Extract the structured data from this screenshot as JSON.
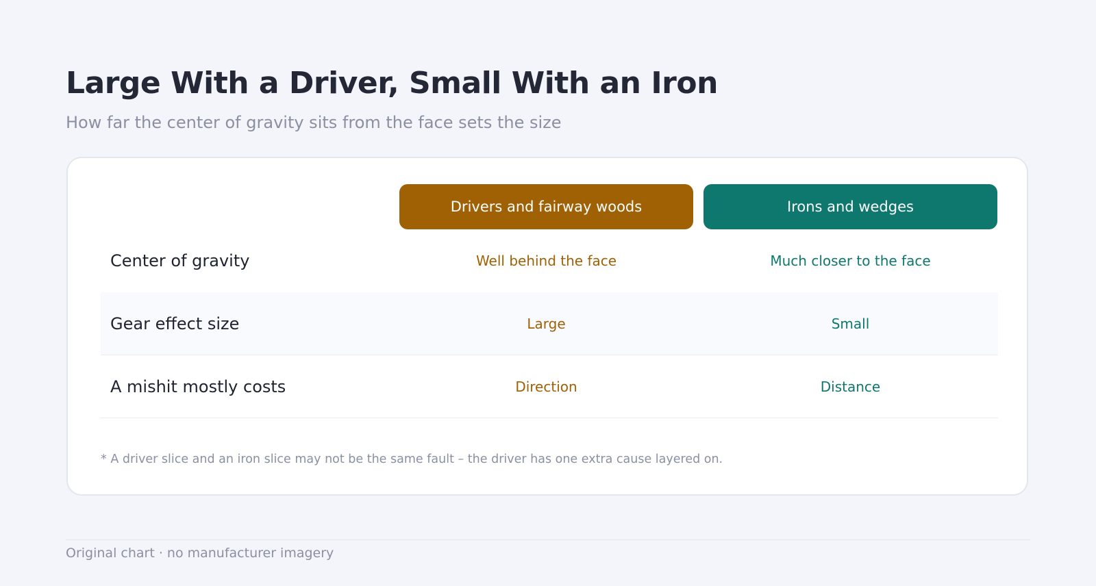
{
  "header": {
    "title": "Large With a Driver, Small With an Iron",
    "subtitle": "How far the center of gravity sits from the face sets the size"
  },
  "table": {
    "columns": [
      "Drivers and fairway woods",
      "Irons and wedges"
    ],
    "column_colors": [
      "#a06105",
      "#0f786e"
    ],
    "rows": [
      {
        "label": "Center of gravity",
        "values": [
          "Well behind the face",
          "Much closer to the face"
        ]
      },
      {
        "label": "Gear effect size",
        "values": [
          "Large",
          "Small"
        ]
      },
      {
        "label": "A mishit mostly costs",
        "values": [
          "Direction",
          "Distance"
        ]
      }
    ],
    "footnote": "* A driver slice and an iron slice may not be the same fault – the driver has one extra cause layered on."
  },
  "footer": {
    "note": "Original chart · no manufacturer imagery"
  }
}
